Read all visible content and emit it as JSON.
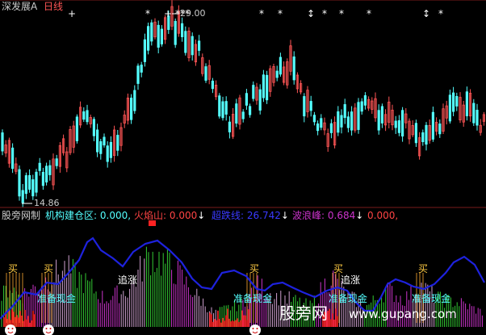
{
  "top_panel": {
    "stock_name": "深发展A",
    "period": "日线",
    "high_label": "29.00",
    "low_label": "14.86"
  },
  "indicator_bar": {
    "name": "股旁网制",
    "items": [
      {
        "label": "机构建仓区",
        "value": "0.000",
        "arrow": ""
      },
      {
        "label": "火焰山",
        "value": "0.000",
        "arrow": "↓"
      },
      {
        "label": "超跌线",
        "value": "26.742",
        "arrow": "↓"
      },
      {
        "label": "波浪峰",
        "value": "0.684",
        "arrow": "↓"
      },
      {
        "label": "",
        "value": "0.000",
        "arrow": ""
      }
    ]
  },
  "annotations": {
    "buy": [
      "买",
      "买",
      "买",
      "买",
      "买"
    ],
    "chase": [
      "追涨",
      "追涨"
    ],
    "cash": [
      "准备现金",
      "准备现金",
      "准备现金",
      "准备现金"
    ]
  },
  "watermark": {
    "cn": "股旁网",
    "url": "www.gupang.com"
  },
  "colors": {
    "background": "#000000",
    "up": "#ff5555",
    "down": "#54ffff",
    "blue_line": "#1e22dd",
    "purple": "#cc33cc",
    "green": "#33cc33",
    "yellow": "#ffff33"
  }
}
